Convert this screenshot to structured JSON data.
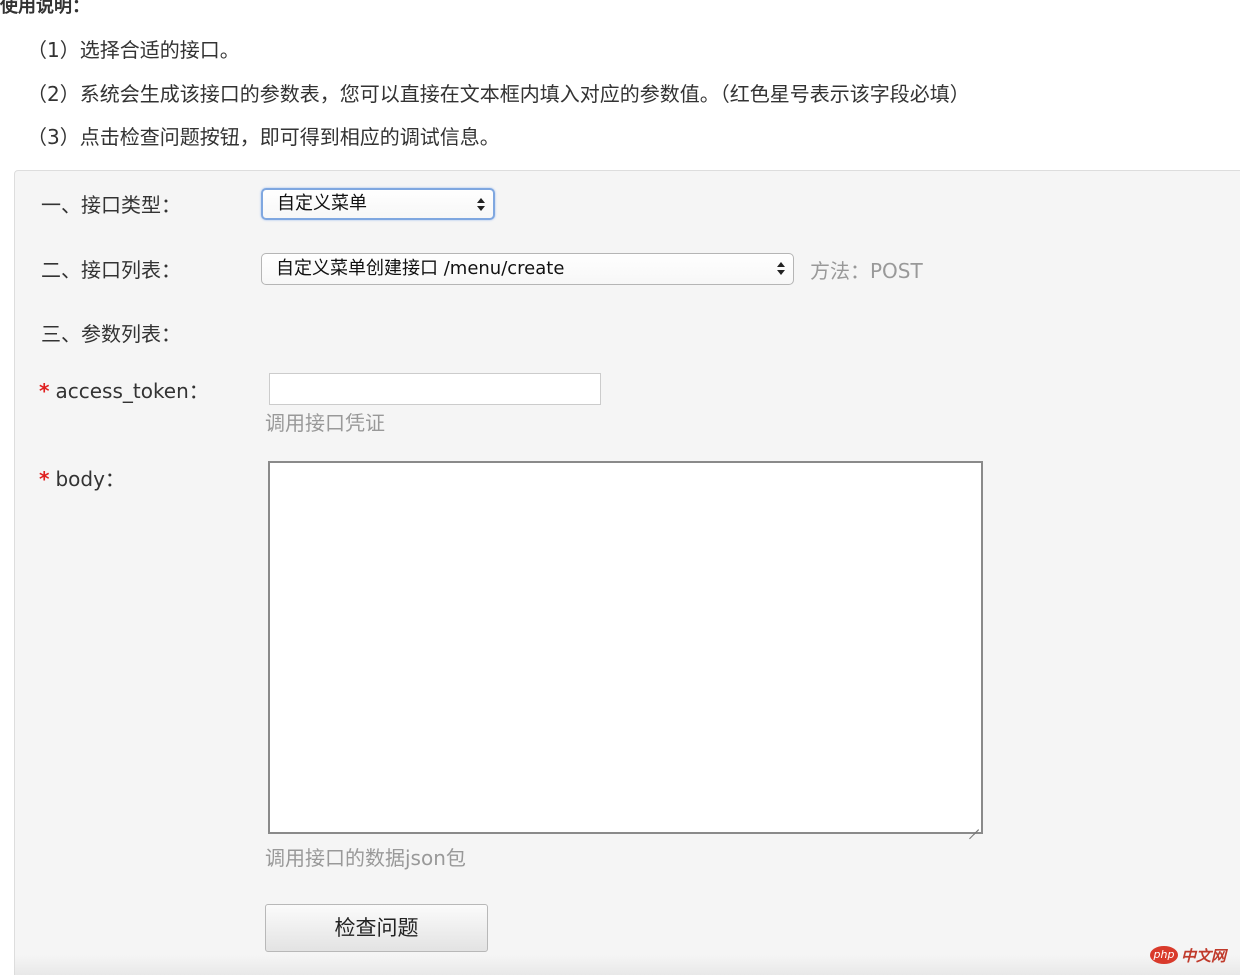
{
  "usage": {
    "title": "使用说明：",
    "steps": [
      "（1）选择合适的接口。",
      "（2）系统会生成该接口的参数表，您可以直接在文本框内填入对应的参数值。（红色星号表示该字段必填）",
      "（3）点击检查问题按钮，即可得到相应的调试信息。"
    ]
  },
  "form": {
    "type_label": "一、接口类型：",
    "type_value": "自定义菜单",
    "list_label": "二、接口列表：",
    "list_value": "自定义菜单创建接口 /menu/create",
    "method_text": "方法：POST",
    "params_label": "三、参数列表：",
    "required_mark": "*",
    "access_token": {
      "label": "access_token：",
      "value": "",
      "hint": "调用接口凭证"
    },
    "body": {
      "label": "body：",
      "value": "",
      "hint": "调用接口的数据json包"
    },
    "submit_label": "检查问题"
  },
  "watermark": {
    "logo": "php",
    "text": "中文网"
  },
  "colors": {
    "required_star": "#e02020",
    "hint_text": "#999999",
    "panel_bg": "#f5f5f5",
    "select_focus": "#7fa7e0",
    "watermark": "#d93a2b"
  }
}
